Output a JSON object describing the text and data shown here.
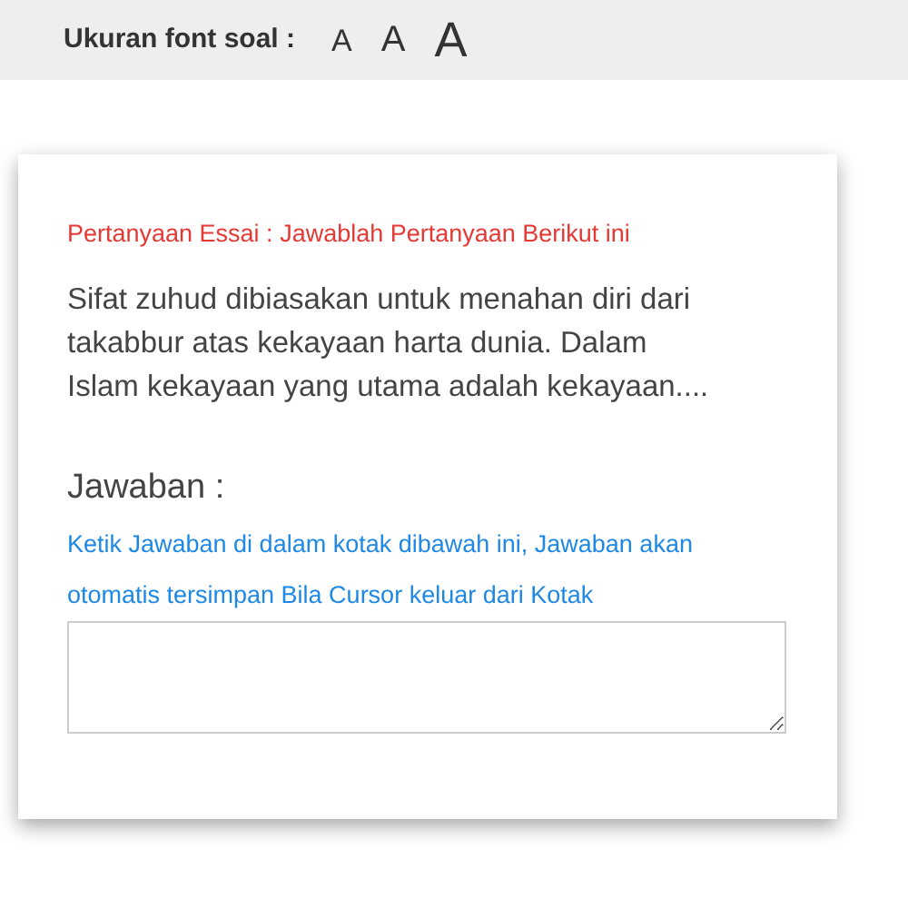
{
  "toolbar": {
    "label": "Ukuran font soal :",
    "font_size_buttons": [
      {
        "label": "A",
        "kind": "small"
      },
      {
        "label": "A",
        "kind": "medium"
      },
      {
        "label": "A",
        "kind": "large"
      }
    ]
  },
  "question_card": {
    "heading": "Pertanyaan Essai : Jawablah Pertanyaan Berikut ini",
    "question": "Sifat zuhud dibiasakan untuk menahan diri dari takabbur atas kekayaan harta dunia. Dalam Islam kekayaan yang utama adalah kekayaan....",
    "answer_label": "Jawaban :",
    "answer_hint": "Ketik Jawaban di dalam kotak dibawah ini, Jawaban akan otomatis tersimpan Bila Cursor keluar dari Kotak"
  }
}
